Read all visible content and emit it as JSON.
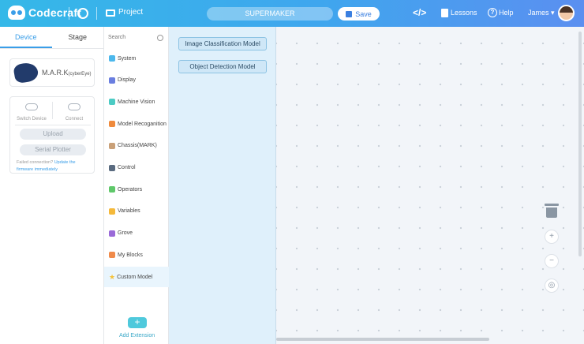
{
  "app": {
    "brand": "Codecraft",
    "project_label": "Project",
    "project_name": "SUPERMAKER",
    "save_label": "Save"
  },
  "nav": {
    "code_label": "</>",
    "lessons_label": "Lessons",
    "help_label": "Help",
    "user_name": "James"
  },
  "device_panel": {
    "tabs": [
      "Device",
      "Stage"
    ],
    "device_name": "M.A.R.K",
    "device_sub": "(cyberEye)",
    "switch_label": "Switch Device",
    "connect_label": "Connect",
    "upload_label": "Upload",
    "serial_label": "Serial Plotter",
    "fail_text": "Failed connection?",
    "fail_link": "Update the firmware immediately"
  },
  "categories": {
    "search_placeholder": "Search",
    "items": [
      {
        "label": "System",
        "color": "#4cb8ec"
      },
      {
        "label": "Display",
        "color": "#6a7ee0"
      },
      {
        "label": "Machine Vision",
        "color": "#4ccbc4"
      },
      {
        "label": "Model Recoganition",
        "color": "#ef8a3c"
      },
      {
        "label": "Chassis(MARK)",
        "color": "#c9a078"
      },
      {
        "label": "Control",
        "color": "#5a6b80"
      },
      {
        "label": "Operators",
        "color": "#5fc86a"
      },
      {
        "label": "Variables",
        "color": "#f5b93a"
      },
      {
        "label": "Grove",
        "color": "#9a6ad8"
      },
      {
        "label": "My Blocks",
        "color": "#f08a4a"
      },
      {
        "label": "Custom Model",
        "color": "#f5c23a"
      }
    ],
    "add_extension": "Add Extension"
  },
  "palette": {
    "blocks": [
      "Image Classification Model",
      "Object Detection Model"
    ]
  }
}
